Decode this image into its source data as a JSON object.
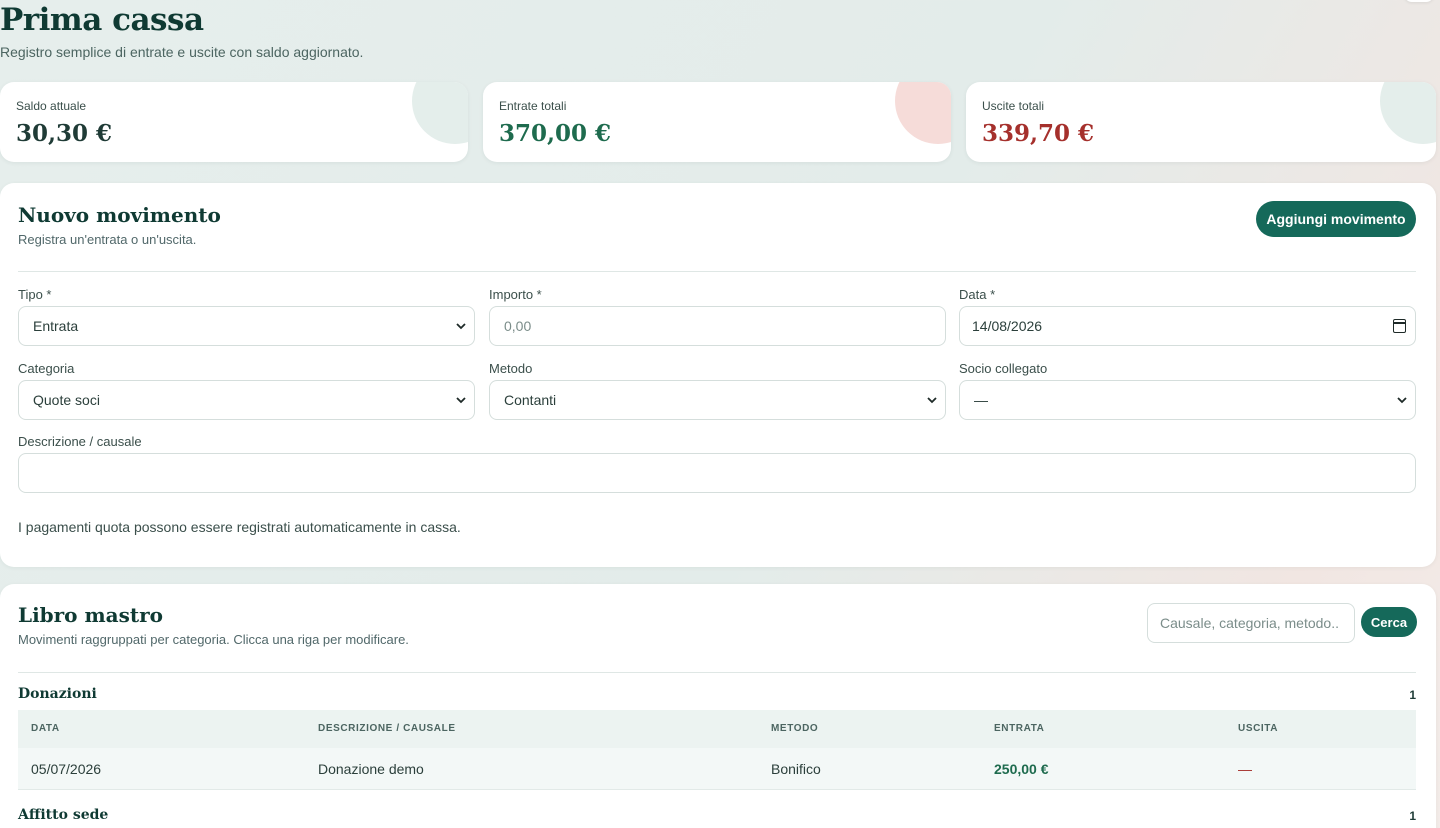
{
  "header": {
    "title": "Prima cassa",
    "subtitle": "Registro semplice di entrate e uscite con saldo aggiornato."
  },
  "stats": [
    {
      "label": "Saldo attuale",
      "value": "30,30 €",
      "color": "#1f3b36"
    },
    {
      "label": "Entrate totali",
      "value": "370,00 €",
      "color": "#1e6b4e"
    },
    {
      "label": "Uscite totali",
      "value": "339,70 €",
      "color": "#a5302c"
    }
  ],
  "colors": {
    "accent": "#15695a",
    "income": "#1e6b4e",
    "expense": "#a5302c"
  },
  "form": {
    "title": "Nuovo movimento",
    "subtitle": "Registra un'entrata o un'uscita.",
    "submit_label": "Aggiungi movimento",
    "fields": {
      "tipo": {
        "label": "Tipo *",
        "value": "Entrata"
      },
      "importo": {
        "label": "Importo *",
        "placeholder": "0,00"
      },
      "data": {
        "label": "Data *",
        "value": "14/08/2026"
      },
      "categoria": {
        "label": "Categoria",
        "value": "Quote soci"
      },
      "metodo": {
        "label": "Metodo",
        "value": "Contanti"
      },
      "socio": {
        "label": "Socio collegato",
        "value": "—"
      },
      "descrizione": {
        "label": "Descrizione / causale",
        "value": ""
      }
    },
    "note": "I pagamenti quota possono essere registrati automaticamente in cassa."
  },
  "ledger": {
    "title": "Libro mastro",
    "subtitle": "Movimenti raggruppati per categoria. Clicca una riga per modificare.",
    "search_placeholder": "Causale, categoria, metodo..",
    "search_button": "Cerca",
    "columns": [
      "DATA",
      "DESCRIZIONE / CAUSALE",
      "METODO",
      "ENTRATA",
      "USCITA"
    ],
    "groups": [
      {
        "name": "Donazioni",
        "count": "1",
        "rows": [
          {
            "data": "05/07/2026",
            "descrizione": "Donazione demo",
            "metodo": "Bonifico",
            "entrata": "250,00 €",
            "uscita": "—"
          }
        ]
      },
      {
        "name": "Affitto sede",
        "count": "1",
        "rows": []
      }
    ]
  }
}
